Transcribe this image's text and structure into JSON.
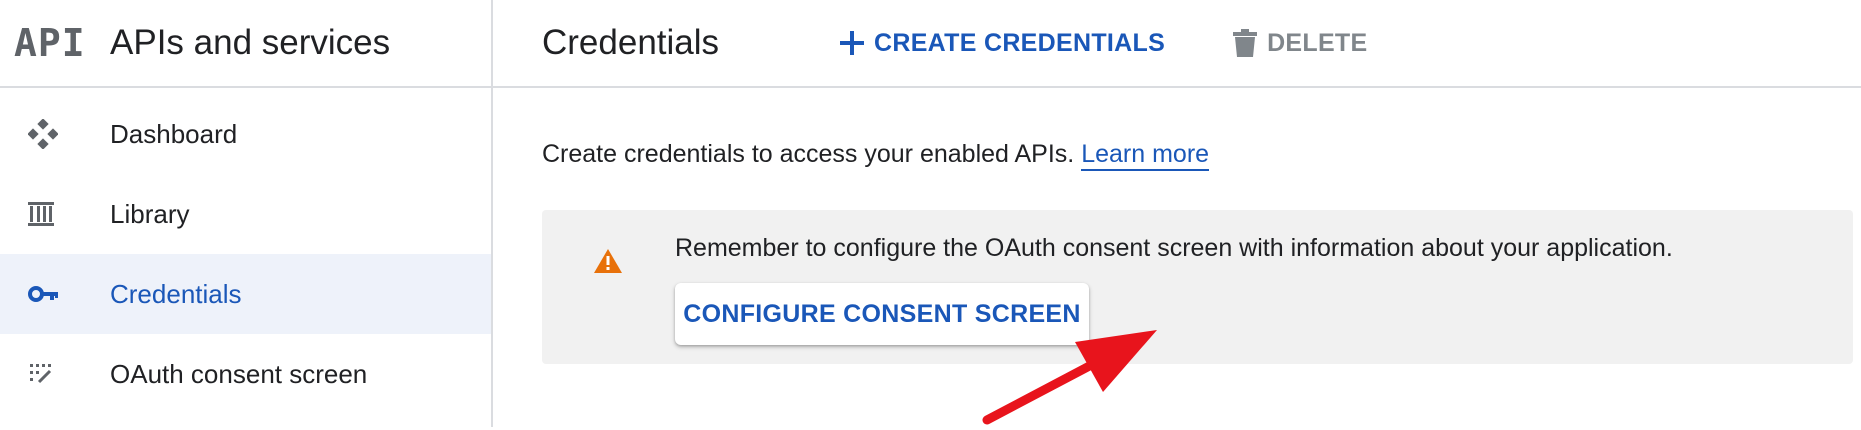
{
  "brand": {
    "logo_text": "API",
    "title": "APIs and services"
  },
  "sidebar": {
    "items": [
      {
        "label": "Dashboard",
        "icon": "dashboard-icon",
        "active": false
      },
      {
        "label": "Library",
        "icon": "library-icon",
        "active": false
      },
      {
        "label": "Credentials",
        "icon": "key-icon",
        "active": true
      },
      {
        "label": "OAuth consent screen",
        "icon": "consent-icon",
        "active": false
      }
    ]
  },
  "header": {
    "title": "Credentials",
    "create_label": "CREATE CREDENTIALS",
    "delete_label": "DELETE"
  },
  "main": {
    "intro_text": "Create credentials to access your enabled APIs.",
    "learn_more": "Learn more",
    "notice": {
      "message": "Remember to configure the OAuth consent screen with information about your application.",
      "button_label": "CONFIGURE CONSENT SCREEN"
    }
  },
  "colors": {
    "accent": "#1a57b8",
    "active_bg": "#eef2fa",
    "warning": "#e8710a",
    "annotation_arrow": "#e8141c"
  }
}
